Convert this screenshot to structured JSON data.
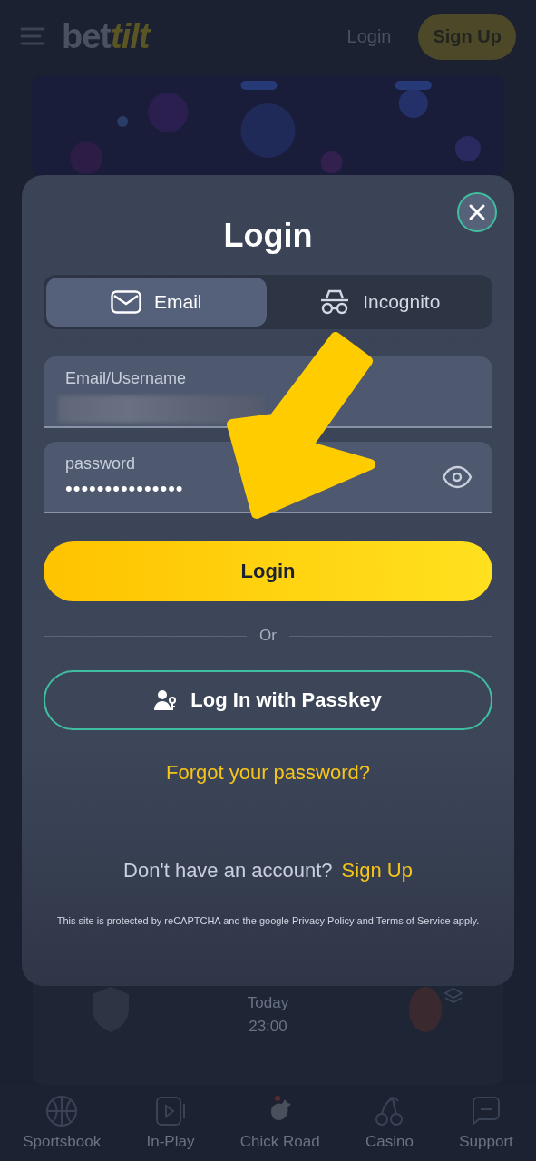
{
  "header": {
    "logo": [
      "bet",
      "tilt"
    ],
    "login": "Login",
    "signup": "Sign Up"
  },
  "match": {
    "day": "Today",
    "time": "23:00"
  },
  "bottom_nav": [
    {
      "label": "Sportsbook",
      "kind": "ball"
    },
    {
      "label": "In-Play",
      "kind": "play"
    },
    {
      "label": "Chick Road",
      "kind": "chicken"
    },
    {
      "label": "Casino",
      "kind": "cherries"
    },
    {
      "label": "Support",
      "kind": "chat"
    }
  ],
  "modal": {
    "title": "Login",
    "tabs": [
      {
        "label": "Email",
        "kind": "email",
        "selected": true
      },
      {
        "label": "Incognito",
        "kind": "incognito",
        "selected": false
      }
    ],
    "fields": [
      {
        "label": "Email/Username",
        "kind": "redacted"
      },
      {
        "label": "password",
        "kind": "password",
        "value": "•••••••••••••••"
      }
    ],
    "submit": "Login",
    "divider": "Or",
    "passkey": "Log In with Passkey",
    "forgot": "Forgot your password?",
    "signup_prompt": "Don't have an account?",
    "signup_link": "Sign Up",
    "legal": "This site is protected by reCAPTCHA and the google Privacy Policy and Terms of Service apply."
  }
}
